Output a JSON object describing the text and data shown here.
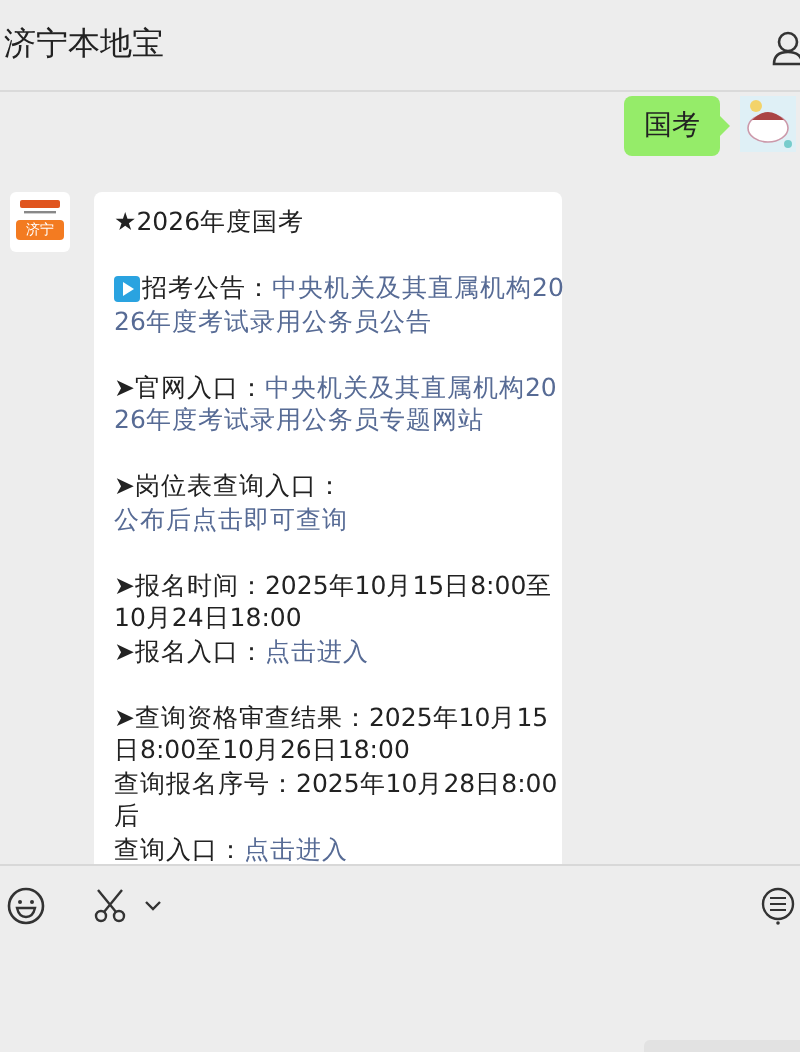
{
  "header": {
    "title": "济宁本地宝"
  },
  "messages": [
    {
      "kind": "outgoing",
      "text": "国考"
    },
    {
      "kind": "incoming",
      "avatar_label": "济宁",
      "paragraphs": [
        [
          [
            {
              "kind": "plain",
              "text": "★2026年度国考"
            }
          ]
        ],
        [
          [
            {
              "kind": "play"
            },
            {
              "kind": "plain",
              "text": "招考公告："
            },
            {
              "kind": "link",
              "text": "中央机关及其直属机构20"
            }
          ],
          [
            {
              "kind": "link",
              "text": "26年度考试录用公务员公告"
            }
          ]
        ],
        [
          [
            {
              "kind": "plain",
              "text": "➤官网入口："
            },
            {
              "kind": "link",
              "text": "中央机关及其直属机构20"
            }
          ],
          [
            {
              "kind": "link",
              "text": "26年度考试录用公务员专题网站"
            }
          ]
        ],
        [
          [
            {
              "kind": "plain",
              "text": "➤岗位表查询入口："
            }
          ],
          [
            {
              "kind": "link",
              "text": "公布后点击即可查询"
            }
          ]
        ],
        [
          [
            {
              "kind": "plain",
              "text": "➤报名时间：2025年10月15日8:00至"
            }
          ],
          [
            {
              "kind": "plain",
              "text": "10月24日18:00"
            }
          ],
          [
            {
              "kind": "plain",
              "text": "➤报名入口："
            },
            {
              "kind": "link",
              "text": "点击进入"
            }
          ]
        ],
        [
          [
            {
              "kind": "plain",
              "text": "➤查询资格审查结果：2025年10月15"
            }
          ],
          [
            {
              "kind": "plain",
              "text": "日8:00至10月26日18:00"
            }
          ],
          [
            {
              "kind": "plain",
              "text": "查询报名序号：2025年10月28日8:00"
            }
          ],
          [
            {
              "kind": "plain",
              "text": "后"
            }
          ],
          [
            {
              "kind": "plain",
              "text": "查询入口："
            },
            {
              "kind": "link",
              "text": "点击进入"
            }
          ]
        ]
      ]
    }
  ]
}
